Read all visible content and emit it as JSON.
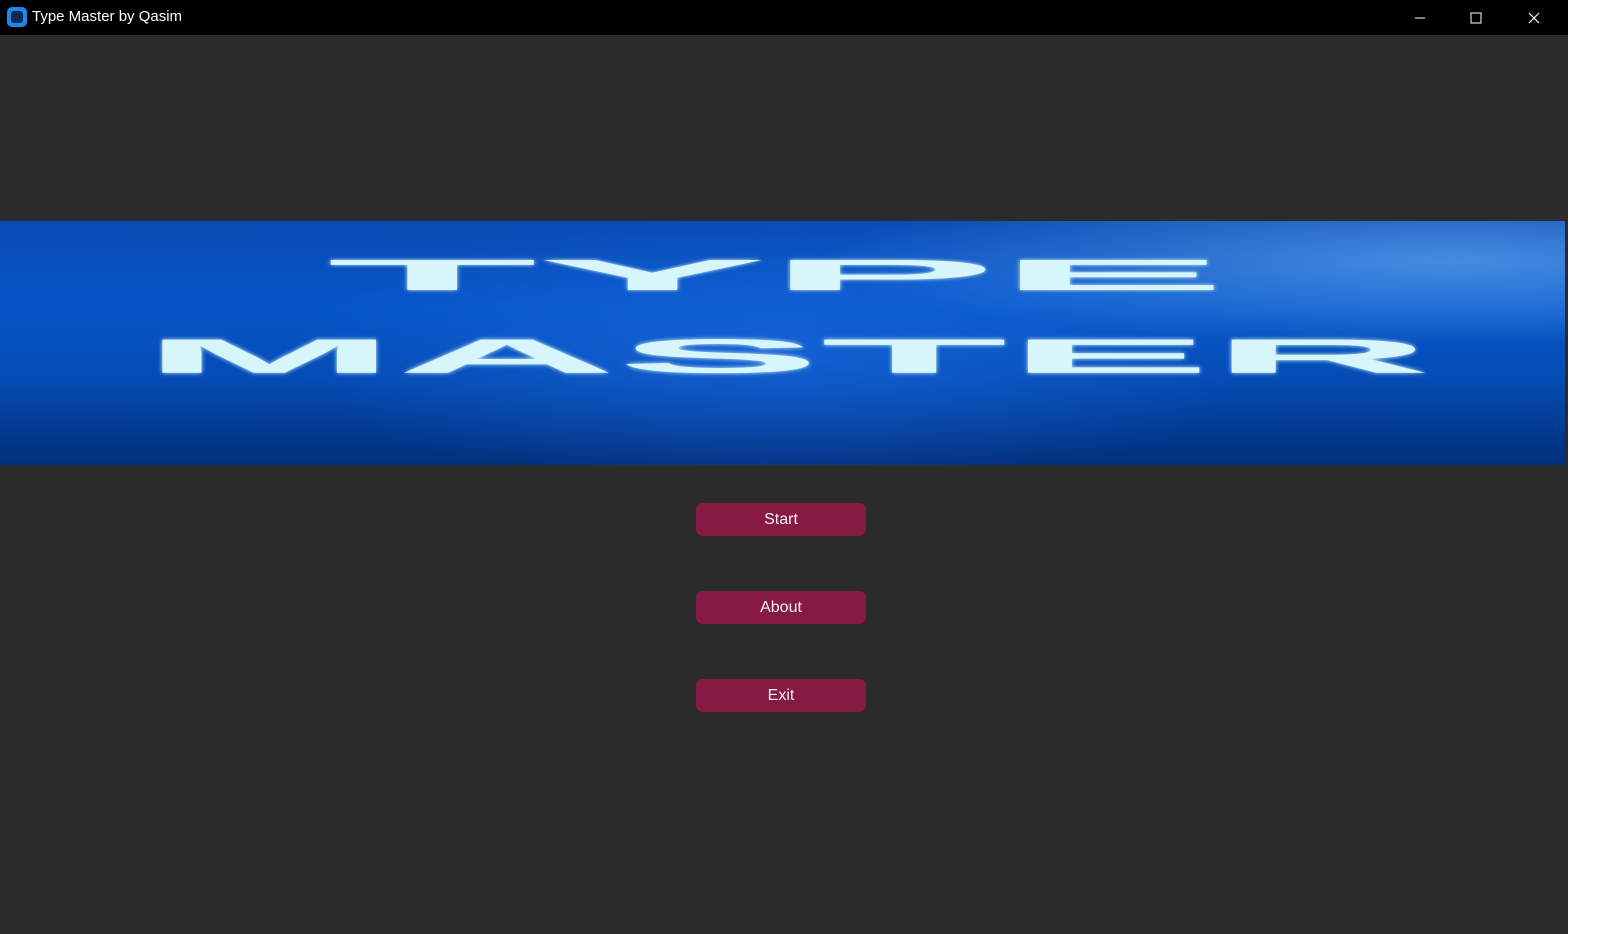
{
  "window": {
    "title": "Type Master by Qasim",
    "icon": "app-window-icon",
    "controls": {
      "minimize_icon": "minimize-icon",
      "maximize_icon": "maximize-icon",
      "close_icon": "close-icon"
    }
  },
  "banner": {
    "line1": "TYPE",
    "line2": "MASTER"
  },
  "menu": {
    "start_label": "Start",
    "about_label": "About",
    "exit_label": "Exit"
  },
  "colors": {
    "background": "#2b2b2b",
    "titlebar": "#000000",
    "button": "#861a42",
    "banner_blue": "#0656c9",
    "banner_text": "#d6f6fb"
  }
}
